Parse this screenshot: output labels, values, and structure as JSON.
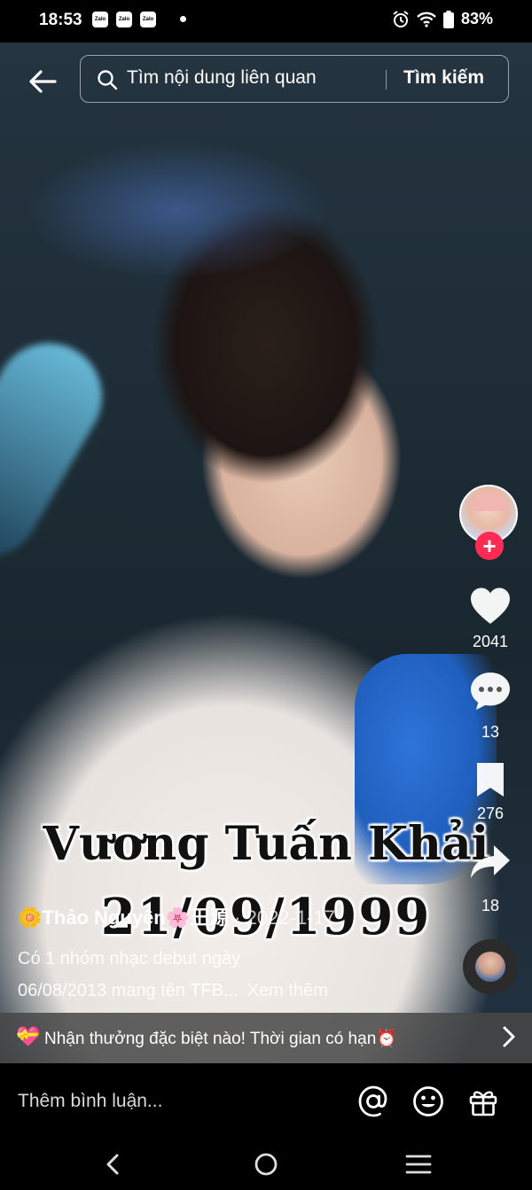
{
  "status_bar": {
    "time": "18:53",
    "notification_apps": [
      "Zalo",
      "Zalo",
      "Zalo"
    ],
    "battery": "83%"
  },
  "search": {
    "placeholder": "Tìm nội dung liên quan",
    "button_label": "Tìm kiếm"
  },
  "video_overlay": {
    "title_line1": "Vương Tuấn Khải",
    "title_line2": "21/09/1999"
  },
  "actions": {
    "likes": "2041",
    "comments": "13",
    "saves": "276",
    "shares": "18"
  },
  "post": {
    "author": "🌼Thảo Nguyên🌸王源",
    "date": " · 2022-1-17",
    "caption_line1": "Có 1 nhóm nhạc debut ngày",
    "caption_line2": "06/08/2013 mang tên TFB...",
    "see_more": "Xem thêm"
  },
  "promo": {
    "text": "Nhận thưởng đặc biệt nào! Thời gian có hạn⏰"
  },
  "comment_bar": {
    "placeholder": "Thêm bình luận..."
  },
  "colors": {
    "follow_accent": "#fe2c55",
    "promo_background": "#464646"
  }
}
